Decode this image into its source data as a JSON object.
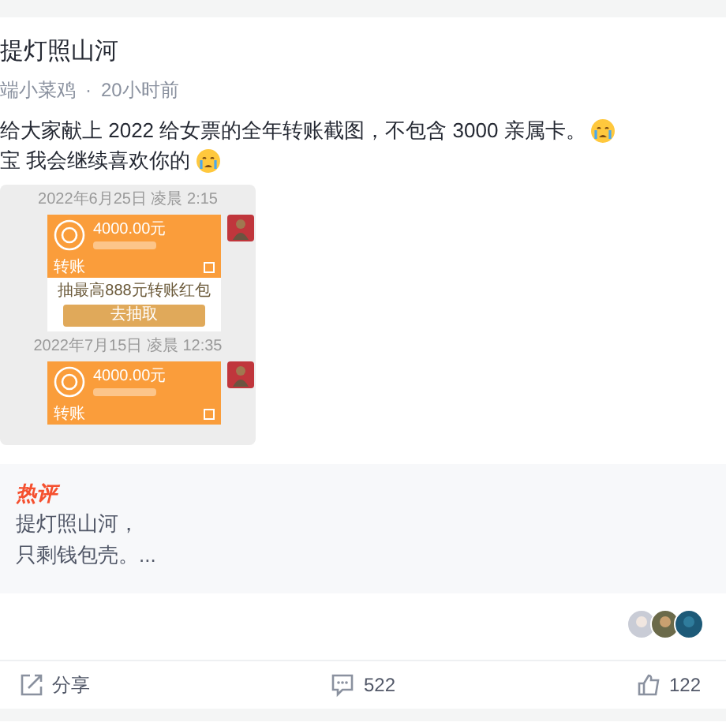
{
  "post": {
    "title": "提灯照山河",
    "author": "端小菜鸡",
    "separator": "·",
    "time": "20小时前",
    "body": [
      {
        "text": "给大家献上 2022 给女票的全年转账截图，不包含 3000 亲属卡。"
      },
      {
        "text": "宝 我会继续喜欢你的"
      }
    ]
  },
  "screenshot": {
    "messages": [
      {
        "date": "2022年6月25日 凌晨 2:15",
        "amount": "4000.00元",
        "label": "转账",
        "promo": "抽最高888元转账红包",
        "promo_button": "去抽取"
      },
      {
        "date": "2022年7月15日 凌晨 12:35",
        "amount": "4000.00元",
        "label": "转账"
      }
    ]
  },
  "hot_comment": {
    "badge": "热评",
    "lines": [
      "提灯照山河，",
      "只剩钱包壳。..."
    ]
  },
  "actions": [
    {
      "kind": "share",
      "label": "分享"
    },
    {
      "kind": "comment",
      "label": "522"
    },
    {
      "kind": "like",
      "label": "122"
    }
  ]
}
